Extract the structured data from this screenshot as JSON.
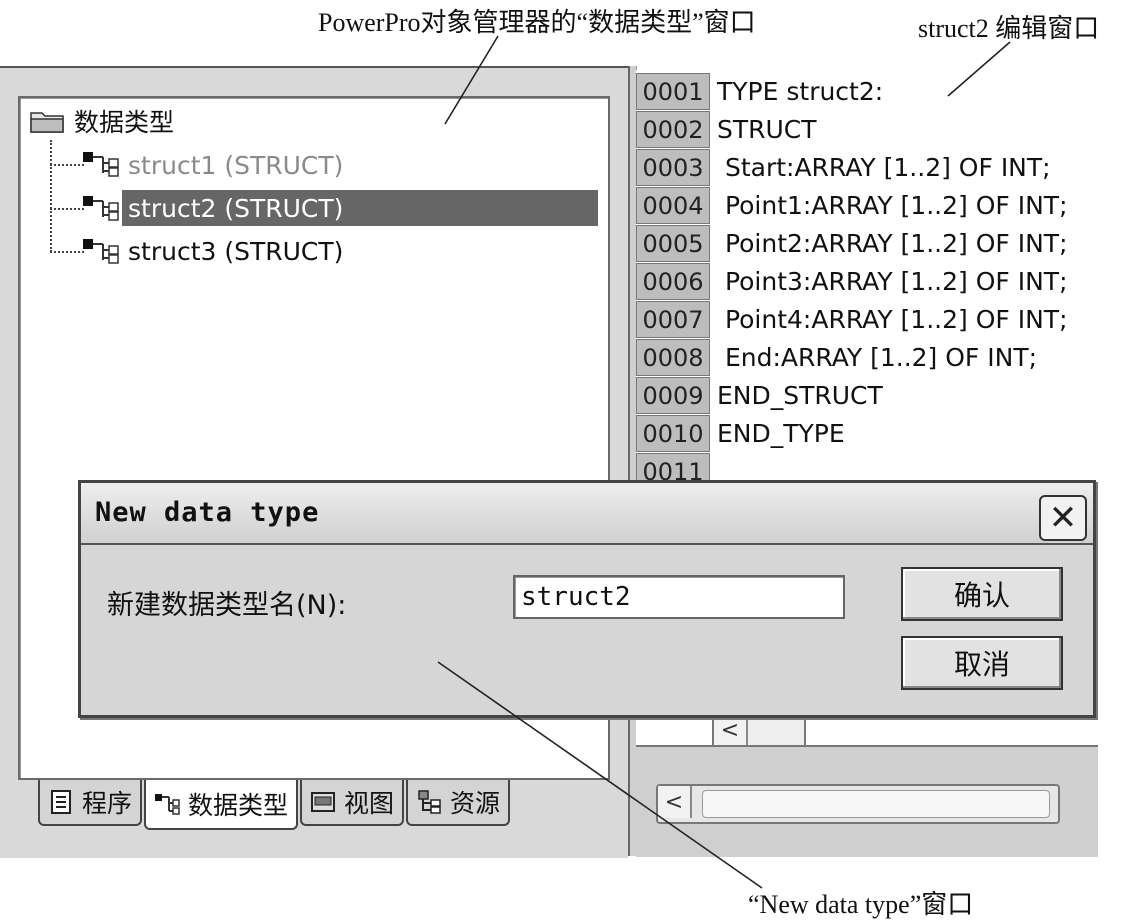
{
  "captions": {
    "object_manager": "PowerPro对象管理器的“数据类型”窗口",
    "editor": "struct2 编辑窗口",
    "dialog": "“New data type”窗口"
  },
  "tree": {
    "root_label": "数据类型",
    "items": [
      {
        "label": "struct1 (STRUCT)",
        "state": "dim"
      },
      {
        "label": "struct2 (STRUCT)",
        "state": "selected"
      },
      {
        "label": "struct3 (STRUCT)",
        "state": "normal"
      }
    ]
  },
  "tabs": [
    {
      "label": "程序",
      "icon": "document-icon"
    },
    {
      "label": "数据类型",
      "icon": "struct-icon",
      "active": true
    },
    {
      "label": "视图",
      "icon": "view-icon"
    },
    {
      "label": "资源",
      "icon": "resource-icon"
    }
  ],
  "editor": {
    "lines": [
      {
        "no": "0001",
        "code": "TYPE struct2:"
      },
      {
        "no": "0002",
        "code": "STRUCT"
      },
      {
        "no": "0003",
        "code": " Start:ARRAY [1..2] OF INT;"
      },
      {
        "no": "0004",
        "code": " Point1:ARRAY [1..2] OF INT;"
      },
      {
        "no": "0005",
        "code": " Point2:ARRAY [1..2] OF INT;"
      },
      {
        "no": "0006",
        "code": " Point3:ARRAY [1..2] OF INT;"
      },
      {
        "no": "0007",
        "code": " Point4:ARRAY [1..2] OF INT;"
      },
      {
        "no": "0008",
        "code": " End:ARRAY [1..2] OF INT;"
      },
      {
        "no": "0009",
        "code": "END_STRUCT"
      },
      {
        "no": "0010",
        "code": "END_TYPE"
      },
      {
        "no": "0011",
        "code": ""
      }
    ]
  },
  "dialog": {
    "title": "New data type",
    "label": "新建数据类型名(N):",
    "input_value": "struct2",
    "ok_label": "确认",
    "cancel_label": "取消",
    "close_glyph": "✕"
  },
  "scroll": {
    "left_arrow": "<"
  }
}
